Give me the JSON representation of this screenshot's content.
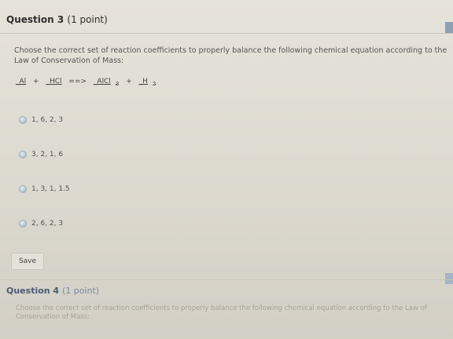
{
  "question3": {
    "label": "Question 3",
    "points": "(1 point)",
    "prompt": "Choose the correct set of reaction coefficients to properly balance the following chemical equation according to the Law of Conservation of Mass:",
    "equation": {
      "t1": "_Al",
      "op1": "+",
      "t2": "_HCl",
      "arrow": "==>",
      "t3_base": "_AlCl",
      "t3_sub": "3",
      "op2": "+",
      "t4_base": "_H",
      "t4_sub": "2"
    },
    "options": [
      "1, 6, 2, 3",
      "3, 2, 1, 6",
      "1, 3, 1, 1.5",
      "2, 6, 2, 3"
    ],
    "save_label": "Save"
  },
  "question4": {
    "label": "Question 4",
    "points": "(1 point)",
    "prompt": "Choose the correct set of reaction coefficients to properly balance the following chemical equation according to the Law of Conservation of Mass:"
  }
}
